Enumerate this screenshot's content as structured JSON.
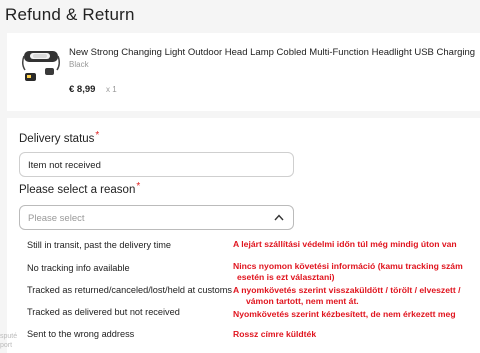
{
  "page": {
    "title": "Refund & Return"
  },
  "product": {
    "title": "New Strong Changing Light Outdoor Head Lamp Cobled Multi-Function Headlight USB Charging",
    "variant": "Black",
    "price": "€ 8,99",
    "quantity": "x 1",
    "image_icon": "headlamp-thumbnail"
  },
  "delivery_status": {
    "label": "Delivery status",
    "required_mark": "*",
    "value": "Item not received"
  },
  "reason": {
    "label": "Please select a reason",
    "required_mark": "*",
    "placeholder": "Please select",
    "options": [
      "Still in transit, past the delivery time",
      "No tracking info available",
      "Tracked as returned/canceled/lost/held at customs",
      "Tracked as delivered but not received",
      "Sent to the wrong address"
    ]
  },
  "annotations": [
    "A lejárt szállítási védelmi időn túl még mindig úton van",
    "Nincs nyomon követési információ (kamu tracking szám",
    "esetén is ezt választani)",
    "A nyomkövetés szerint visszaküldött / törölt / elveszett /",
    "vámon tartott, nem ment át.",
    "Nyomkövetés szerint kézbesített, de nem érkezett meg",
    "Rossz címre küldték"
  ],
  "edge_fragments": [
    "sputé",
    "port"
  ],
  "colors": {
    "annotation": "#e0141e",
    "required": "#e02020",
    "background": "#f5f5f5"
  }
}
